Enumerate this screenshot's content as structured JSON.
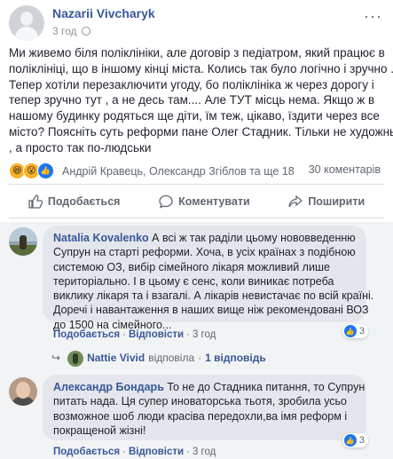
{
  "post": {
    "author": "Nazarii Vivcharyk",
    "time": "3 год",
    "text_lines": [
      "Ми живемо біля поліклініки, але договір з педіатром, який працює в",
      "поліклініці, що в іншому кінці міста. Колись так було логічно і зручно .",
      "Тепер хотіли перезаключити угоду, бо поліклініка ж через дорогу і",
      "тепер зручно тут , а не десь там.... Але ТУТ місць нема. Якщо ж в",
      "нашому будинку родяться ще діти, їм теж, цікаво, їздити через все",
      "місто? Поясніть суть реформи пане Олег Стадник. Тільки не художньо",
      ", а просто так по-людськи"
    ],
    "reactors": "Андрій Кравець, Олександр Згіблов та ще 18",
    "comments_count": "30 коментарів"
  },
  "actions": {
    "like": "Подобається",
    "comment": "Коментувати",
    "share": "Поширити"
  },
  "comments": [
    {
      "author": "Natalia Kovalenko",
      "lines": [
        " А всі ж так раділи цьому нововведенню",
        "Супрун на старті реформи. Хоча, в усіх країнах з подібною",
        "системою ОЗ, вибір сімейного лікаря можливий лише",
        "територіально. І в цьому є сенс, коли виникає потреба",
        "виклику лікаря та і взагалі. А лікарів невистачає по всій країні.",
        "Доречі і навантаження в наших вище ніж рекомендовані ВОЗ",
        "до 1500 на сімейного..."
      ],
      "like_label": "Подобається",
      "reply_label": "Відповісти",
      "time": "3 год",
      "reaction_count": "3"
    },
    {
      "author": "Александр Бондарь",
      "lines": [
        " То не до Стадника питання, то Супрун",
        "питать нада. Ця супер иноваторська тьотя, зробила усьо",
        "возможное шоб люди красіва передохли,ва імя реформ і",
        "покращеной жізні!"
      ],
      "like_label": "Подобається",
      "reply_label": "Відповісти",
      "time": "3 год",
      "reaction_count": "3"
    }
  ],
  "reply_summary": {
    "name": "Nattie Vivid",
    "text": "відповіла",
    "count": "1 відповідь"
  },
  "colors": {
    "link": "#385898",
    "secondary": "#606770",
    "bubble": "#e4e6eb",
    "comment_bg": "#f2f3f5",
    "like_blue": "#1877f2"
  },
  "icons": [
    "globe-icon",
    "more-icon",
    "like-icon",
    "comment-icon",
    "share-icon",
    "reply-arrow-icon"
  ]
}
